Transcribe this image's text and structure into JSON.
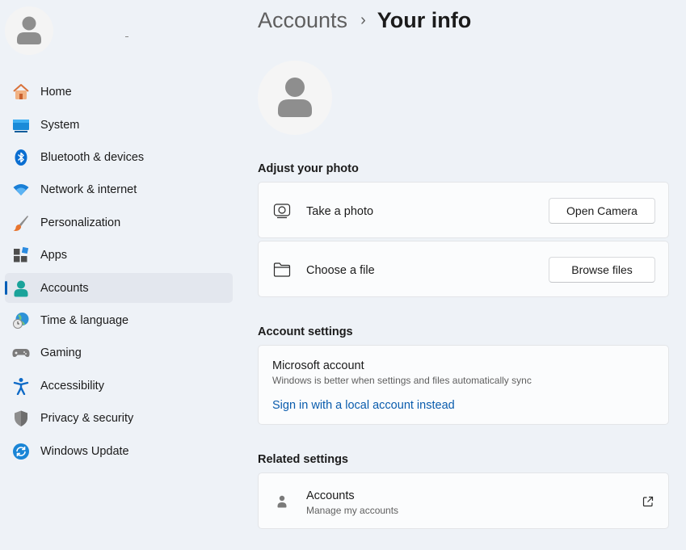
{
  "sidebar": {
    "user": {
      "name": "-"
    },
    "items": [
      {
        "label": "Home",
        "icon": "home-icon"
      },
      {
        "label": "System",
        "icon": "system-icon"
      },
      {
        "label": "Bluetooth & devices",
        "icon": "bluetooth-icon"
      },
      {
        "label": "Network & internet",
        "icon": "wifi-icon"
      },
      {
        "label": "Personalization",
        "icon": "brush-icon"
      },
      {
        "label": "Apps",
        "icon": "apps-icon"
      },
      {
        "label": "Accounts",
        "icon": "accounts-icon",
        "active": true
      },
      {
        "label": "Time & language",
        "icon": "globe-clock-icon"
      },
      {
        "label": "Gaming",
        "icon": "gamepad-icon"
      },
      {
        "label": "Accessibility",
        "icon": "accessibility-icon"
      },
      {
        "label": "Privacy & security",
        "icon": "shield-icon"
      },
      {
        "label": "Windows Update",
        "icon": "update-icon"
      }
    ]
  },
  "breadcrumb": {
    "parent": "Accounts",
    "separator": "›",
    "current": "Your info"
  },
  "photo": {
    "section_title": "Adjust your photo",
    "take_photo_label": "Take a photo",
    "open_camera_button": "Open Camera",
    "choose_file_label": "Choose a file",
    "browse_files_button": "Browse files"
  },
  "account_settings": {
    "section_title": "Account settings",
    "title": "Microsoft account",
    "subtitle": "Windows is better when settings and files automatically sync",
    "link": "Sign in with a local account instead"
  },
  "related": {
    "section_title": "Related settings",
    "title": "Accounts",
    "subtitle": "Manage my accounts"
  },
  "colors": {
    "accent": "#005fb8",
    "link": "#0a5cad",
    "background": "#eef2f7"
  }
}
